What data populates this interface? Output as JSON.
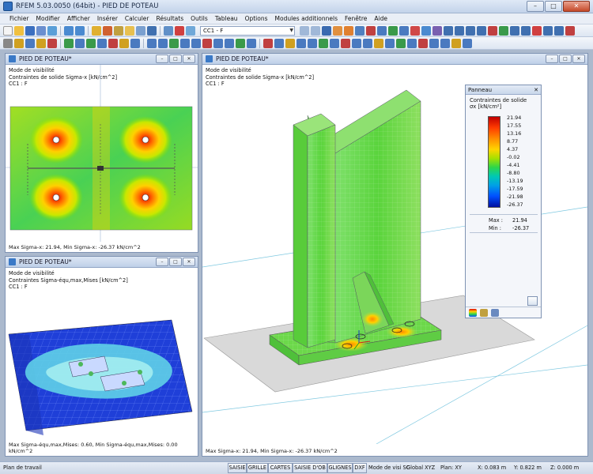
{
  "app": {
    "title": "RFEM 5.03.0050 (64bit) - PIED DE POTEAU",
    "controls": {
      "minimize": "–",
      "maximize": "□",
      "close": "✕"
    }
  },
  "menu": {
    "items": [
      "Fichier",
      "Modifier",
      "Afficher",
      "Insérer",
      "Calculer",
      "Résultats",
      "Outils",
      "Tableau",
      "Options",
      "Modules additionnels",
      "Fenêtre",
      "Aide"
    ]
  },
  "toolbar": {
    "load_case": "CC1 - F"
  },
  "windows": {
    "top_left": {
      "title": "PIED DE POTEAU*",
      "line1": "Mode de visibilité",
      "line2": "Contraintes de solide Sigma-x [kN/cm^2]",
      "line3": "CC1 : F",
      "footer": "Max Sigma-x: 21.94, Min Sigma-x: -26.37 kN/cm^2"
    },
    "bottom_left": {
      "title": "PIED DE POTEAU*",
      "line1": "Mode de visibilité",
      "line2": "Contraintes Sigma-équ,max,Mises [kN/cm^2]",
      "line3": "CC1 : F",
      "footer": "Max Sigma-équ,max,Mises: 0.60, Min Sigma-équ,max,Mises: 0.00 kN/cm^2"
    },
    "main": {
      "title": "PIED DE POTEAU*",
      "line1": "Mode de visibilité",
      "line2": "Contraintes de solide Sigma-x [kN/cm^2]",
      "line3": "CC1 : F",
      "footer": "Max Sigma-x: 21.94, Min Sigma-x: -26.37 kN/cm^2"
    }
  },
  "panel": {
    "title": "Panneau",
    "close": "✕",
    "heading": "Contraintes de solide",
    "unit": "σx [kN/cm²]",
    "scale": [
      "21.94",
      "17.55",
      "13.16",
      "8.77",
      "4.37",
      "-0.02",
      "-4.41",
      "-8.80",
      "-13.19",
      "-17.59",
      "-21.98",
      "-26.37"
    ],
    "max_label": "Max :",
    "max_value": "21.94",
    "min_label": "Min :",
    "min_value": "-26.37"
  },
  "statusbar": {
    "left": "Plan de travail",
    "buttons": [
      "SAISIE",
      "GRILLE",
      "CARTES",
      "SAISIE D'OB",
      "GLIGNES",
      "DXF"
    ],
    "snap": "Mode de visi SC",
    "coord_sys": "Global XYZ",
    "plane": "Plan: XY",
    "x": "X:  0.083 m",
    "y": "Y:  0.822 m",
    "z": "Z:  0.000 m"
  },
  "colors": {
    "accent": "#2f6fc0",
    "stress_high": "#e00000",
    "stress_low": "#0020c0",
    "stress_mid": "#5ad43c"
  }
}
